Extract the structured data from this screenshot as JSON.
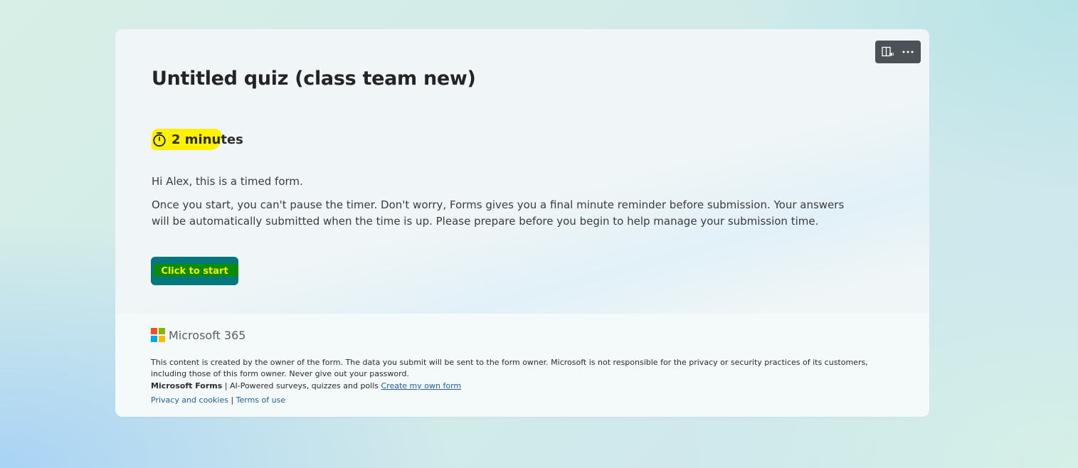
{
  "form": {
    "title": "Untitled quiz (class team new)",
    "timer_label": "2 minutes",
    "greeting": "Hi Alex, this is a timed form.",
    "description": "Once you start, you can't pause the timer. Don't worry, Forms gives you a final minute reminder before submission. Your answers will be automatically submitted when the time is up. Please prepare before you begin to help manage your submission time.",
    "start_button_label": "Click to start"
  },
  "toolbar": {
    "icons": [
      "immersive-reader-icon",
      "more-options-icon"
    ]
  },
  "footer": {
    "brand": "Microsoft 365",
    "disclaimer": "This content is created by the owner of the form. The data you submit will be sent to the form owner. Microsoft is not responsible for the privacy or security practices of its customers, including those of this form owner. Never give out your password.",
    "product_name": "Microsoft Forms",
    "product_tagline": " | AI-Powered surveys, quizzes and polls ",
    "create_link": "Create my own form",
    "privacy_link": "Privacy and cookies",
    "separator": " | ",
    "terms_link": "Terms of use"
  },
  "colors": {
    "start_button": "#03787c",
    "highlight_yellow": "#fff200",
    "highlight_green": "#0b8a0b",
    "toolbar": "#4b5257",
    "link": "#1d5f9a",
    "ms_red": "#f25022",
    "ms_green": "#7fba00",
    "ms_blue": "#00a4ef",
    "ms_yellow": "#ffb900"
  }
}
